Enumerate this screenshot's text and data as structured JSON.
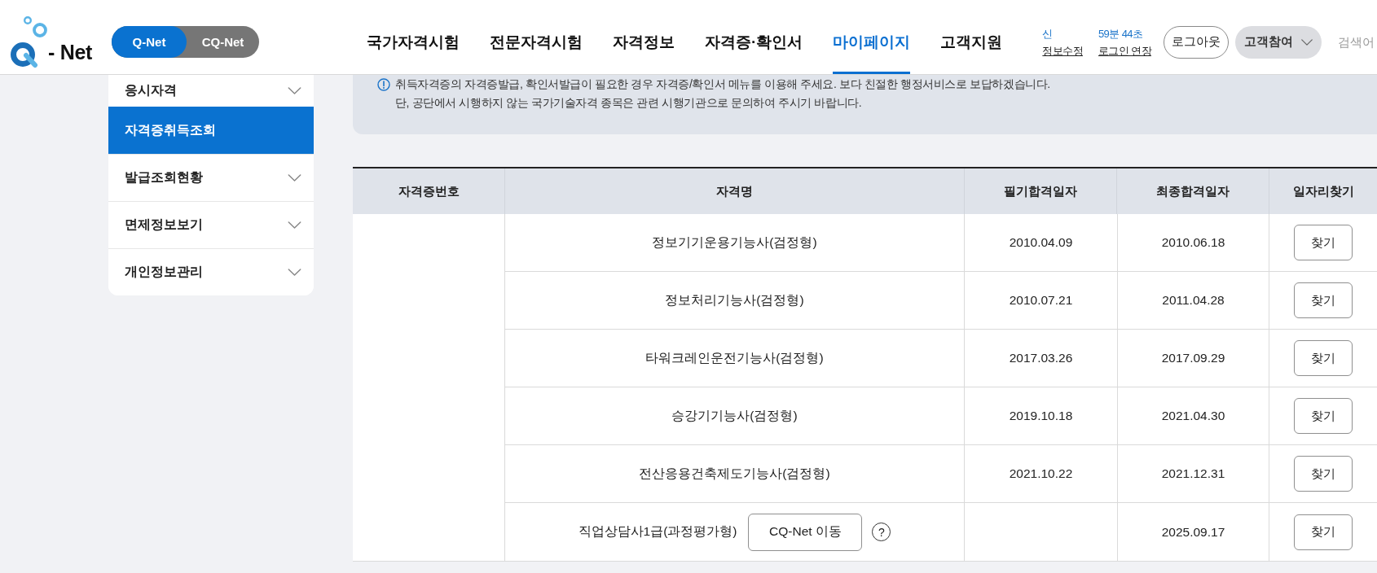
{
  "logo": {
    "text": "- Net"
  },
  "site_switch": [
    {
      "label": "Q-Net",
      "selected": true
    },
    {
      "label": "CQ-Net",
      "selected": false
    }
  ],
  "nav": [
    {
      "label": "국가자격시험",
      "selected": false
    },
    {
      "label": "전문자격시험",
      "selected": false
    },
    {
      "label": "자격정보",
      "selected": false
    },
    {
      "label": "자격증·확인서",
      "selected": false
    },
    {
      "label": "마이페이지",
      "selected": true
    },
    {
      "label": "고객지원",
      "selected": false
    }
  ],
  "account": {
    "name": "신",
    "edit_link": "정보수정"
  },
  "session": {
    "remaining": "59분 44초",
    "extend_link": "로그인 연장"
  },
  "logout_button": "로그아웃",
  "participation_menu": {
    "label": "고객참여"
  },
  "search": {
    "placeholder": "검색어"
  },
  "sidebar": {
    "items": [
      {
        "label": "응시자격",
        "selected": false
      },
      {
        "label": "자격증취득조회",
        "selected": true
      },
      {
        "label": "발급조회현황",
        "selected": false
      },
      {
        "label": "면제정보보기",
        "selected": false
      },
      {
        "label": "개인정보관리",
        "selected": false
      }
    ]
  },
  "notice": {
    "lines": [
      "취득자격증의 자격증발급, 확인서발급이 필요한 경우 자격증/확인서 메뉴를 이용해 주세요. 보다 친절한 행정서비스로 보답하겠습니다.",
      "단, 공단에서 시행하지 않는 국가기술자격 종목은 관련 시행기관으로 문의하여 주시기 바랍니다."
    ]
  },
  "table": {
    "columns": [
      "자격증번호",
      "자격명",
      "필기합격일자",
      "최종합격일자",
      "일자리찾기"
    ],
    "rows": [
      {
        "name": "정보기기운용기능사(검정형)",
        "written_pass_date": "2010.04.09",
        "final_pass_date": "2010.06.18",
        "action": "찾기"
      },
      {
        "name": "정보처리기능사(검정형)",
        "written_pass_date": "2010.07.21",
        "final_pass_date": "2011.04.28",
        "action": "찾기"
      },
      {
        "name": "타워크레인운전기능사(검정형)",
        "written_pass_date": "2017.03.26",
        "final_pass_date": "2017.09.29",
        "action": "찾기"
      },
      {
        "name": "승강기기능사(검정형)",
        "written_pass_date": "2019.10.18",
        "final_pass_date": "2021.04.30",
        "action": "찾기"
      },
      {
        "name": "전산응용건축제도기능사(검정형)",
        "written_pass_date": "2021.10.22",
        "final_pass_date": "2021.12.31",
        "action": "찾기"
      },
      {
        "name": "직업상담사1급(과정평가형)",
        "link_button": "CQ-Net 이동",
        "help_mark": "?",
        "final_pass_date": "2025.09.17",
        "action": "찾기"
      }
    ]
  }
}
